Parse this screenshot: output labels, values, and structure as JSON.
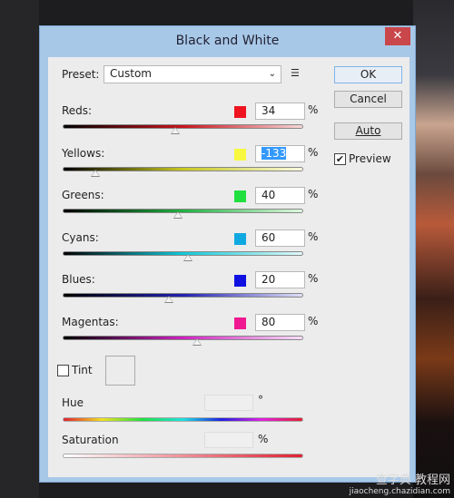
{
  "dialog": {
    "title": "Black and White",
    "close_icon": "close-icon"
  },
  "preset": {
    "label": "Preset:",
    "value": "Custom"
  },
  "buttons": {
    "ok": "OK",
    "cancel": "Cancel",
    "auto": "Auto"
  },
  "preview": {
    "label": "Preview",
    "checked": true
  },
  "range": [
    -200,
    300
  ],
  "sliders": [
    {
      "label": "Reds:",
      "value": "34",
      "unit": "%",
      "color": "#f0141e",
      "gradient": "linear-gradient(90deg,#000,#c8141c 50%,#f8d8d8)"
    },
    {
      "label": "Yellows:",
      "value": "-133",
      "unit": "%",
      "color": "#f8f840",
      "gradient": "linear-gradient(90deg,#000,#c8c820 50%,#fafae0)",
      "selected": true
    },
    {
      "label": "Greens:",
      "value": "40",
      "unit": "%",
      "color": "#20e040",
      "gradient": "linear-gradient(90deg,#000,#20b040 50%,#e0f8e0)"
    },
    {
      "label": "Cyans:",
      "value": "60",
      "unit": "%",
      "color": "#10a8e0",
      "gradient": "linear-gradient(90deg,#000,#10c8d8 50%,#e0f8f8)"
    },
    {
      "label": "Blues:",
      "value": "20",
      "unit": "%",
      "color": "#1010e0",
      "gradient": "linear-gradient(90deg,#000,#2020b0 50%,#e0e0f8)"
    },
    {
      "label": "Magentas:",
      "value": "80",
      "unit": "%",
      "color": "#f01890",
      "gradient": "linear-gradient(90deg,#000,#d020c0 50%,#f8e0f8)"
    }
  ],
  "tint": {
    "label": "Tint",
    "checked": false
  },
  "hue": {
    "label": "Hue",
    "unit": "°"
  },
  "saturation": {
    "label": "Saturation",
    "unit": "%"
  },
  "watermark": {
    "line1": "查字典 教程网",
    "line2": "jiaocheng.chazidian.com"
  }
}
